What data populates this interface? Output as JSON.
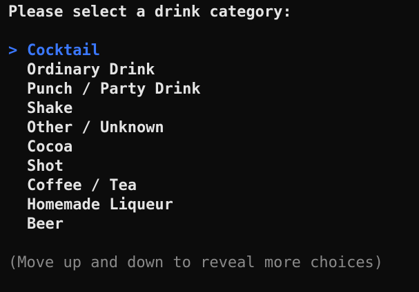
{
  "prompt": {
    "question": "Please select a drink category:"
  },
  "choices": {
    "pointer_symbol": ">",
    "selected_index": 0,
    "items": [
      "Cocktail",
      "Ordinary Drink",
      "Punch / Party Drink",
      "Shake",
      "Other / Unknown",
      "Cocoa",
      "Shot",
      "Coffee / Tea",
      "Homemade Liqueur",
      "Beer"
    ]
  },
  "hint": {
    "text": "(Move up and down to reveal more choices)"
  },
  "colors": {
    "background": "#0c0c0c",
    "foreground": "#e4e4e4",
    "selected": "#3b78ff",
    "hint": "#8a8a8a"
  }
}
